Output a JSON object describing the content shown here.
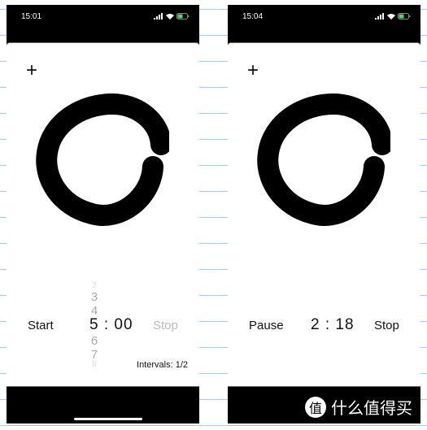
{
  "left_screen": {
    "status_time": "15:01",
    "add_label": "+",
    "start_label": "Start",
    "picker_values": [
      "2",
      "3",
      "4",
      "6",
      "7",
      "8"
    ],
    "timer_minutes": "5",
    "timer_sep": ":",
    "timer_seconds": "00",
    "stop_label": "Stop",
    "intervals": "Intervals: 1/2"
  },
  "right_screen": {
    "status_time": "15:04",
    "add_label": "+",
    "pause_label": "Pause",
    "timer": "2 : 18",
    "stop_label": "Stop"
  },
  "watermark": {
    "logo_char": "值",
    "text": "什么值得买"
  },
  "colors": {
    "battery": "#4cd964",
    "ruled_line": "#9fcaf5",
    "disabled": "#bbbbbb"
  }
}
